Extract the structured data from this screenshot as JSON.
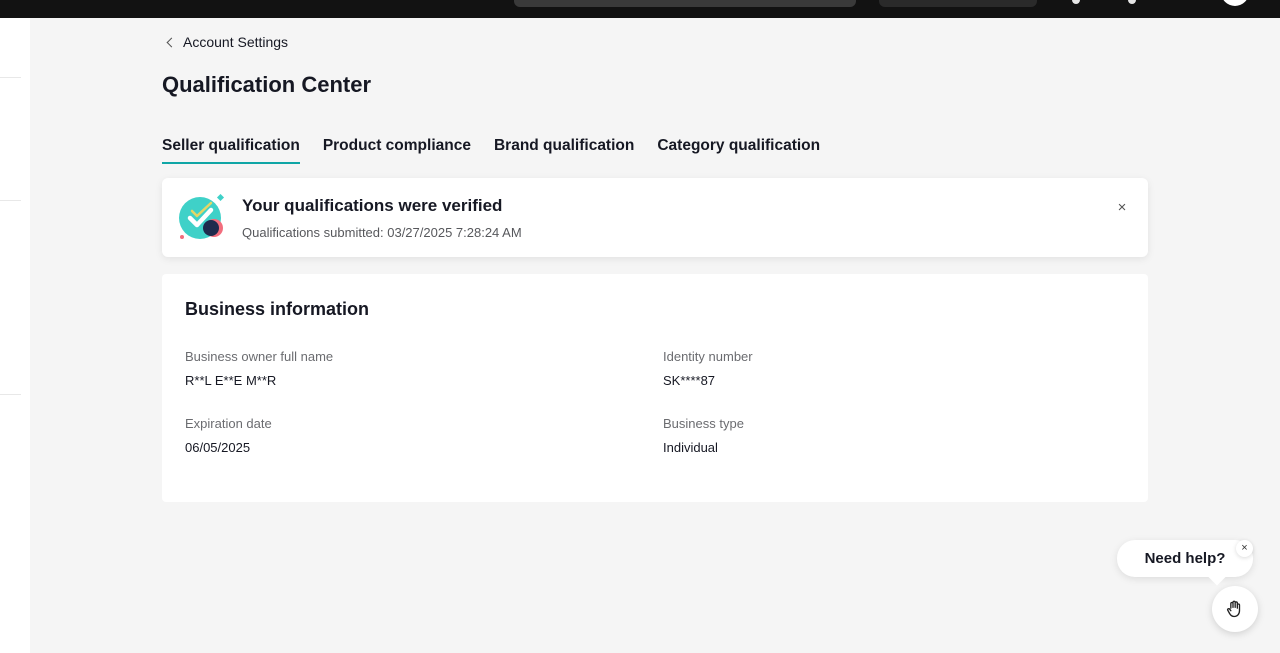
{
  "breadcrumb": {
    "label": "Account Settings"
  },
  "page": {
    "title": "Qualification Center"
  },
  "tabs": [
    {
      "label": "Seller qualification",
      "active": true
    },
    {
      "label": "Product compliance",
      "active": false
    },
    {
      "label": "Brand qualification",
      "active": false
    },
    {
      "label": "Category qualification",
      "active": false
    }
  ],
  "banner": {
    "title": "Your qualifications were verified",
    "subtitle": "Qualifications submitted: 03/27/2025 7:28:24 AM",
    "close_icon": "×",
    "badge_icon": "verified-check-icon",
    "accent_color": "#3fd1c8"
  },
  "business_info": {
    "title": "Business information",
    "fields": [
      {
        "label": "Business owner full name",
        "value": "R**L E**E M**R"
      },
      {
        "label": "Identity number",
        "value": "SK****87"
      },
      {
        "label": "Expiration date",
        "value": "06/05/2025"
      },
      {
        "label": "Business type",
        "value": "Individual"
      }
    ]
  },
  "help": {
    "label": "Need help?",
    "close_icon": "×",
    "button_icon": "hand-wave-icon"
  },
  "colors": {
    "tab_underline": "#0fa6a6",
    "topbar": "#121212",
    "background": "#f5f5f5"
  }
}
